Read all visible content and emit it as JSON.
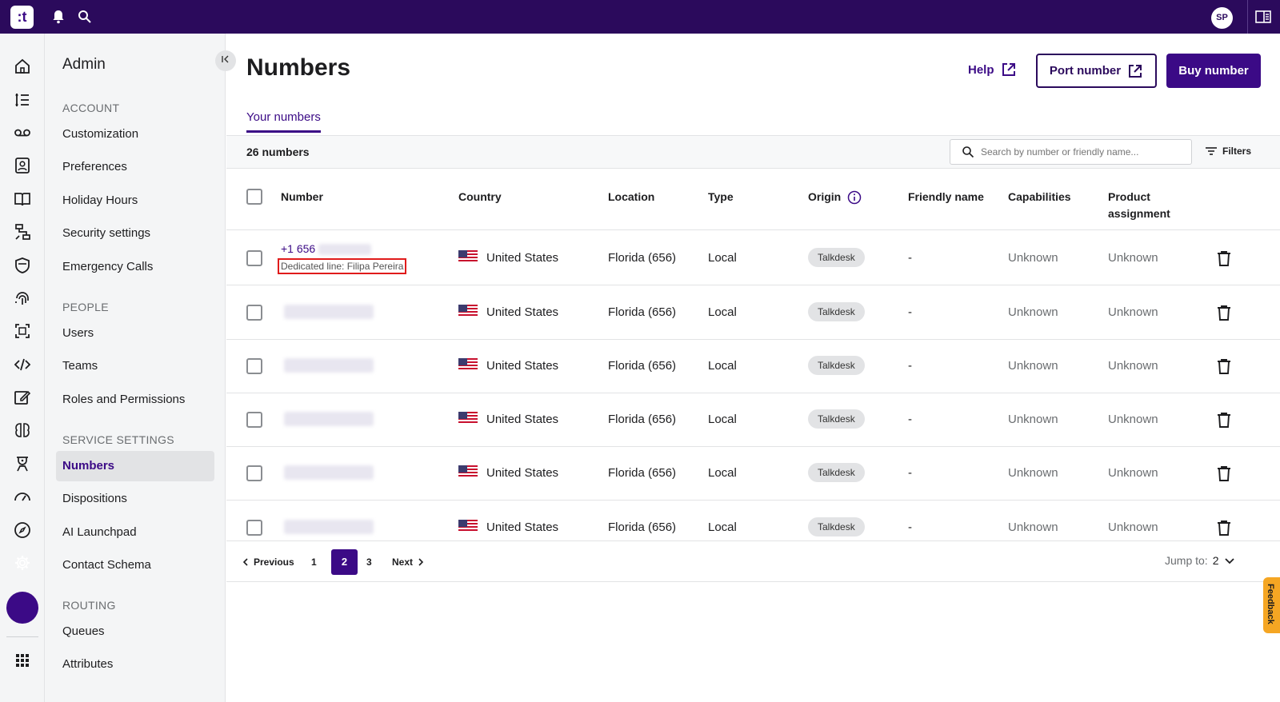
{
  "topbar": {
    "logo": ":t",
    "avatar": "SP"
  },
  "sidebar": {
    "title": "Admin",
    "sections": [
      {
        "label": "ACCOUNT",
        "items": [
          "Customization",
          "Preferences",
          "Holiday Hours",
          "Security settings",
          "Emergency Calls"
        ]
      },
      {
        "label": "PEOPLE",
        "items": [
          "Users",
          "Teams",
          "Roles and Permissions"
        ]
      },
      {
        "label": "SERVICE SETTINGS",
        "items": [
          "Numbers",
          "Dispositions",
          "AI Launchpad",
          "Contact Schema"
        ]
      },
      {
        "label": "ROUTING",
        "items": [
          "Queues",
          "Attributes"
        ]
      }
    ],
    "active_item": "Numbers"
  },
  "page": {
    "title": "Numbers",
    "help_label": "Help",
    "port_label": "Port number",
    "buy_label": "Buy number",
    "tab": "Your numbers",
    "count": "26 numbers",
    "search_placeholder": "Search by number or friendly name...",
    "filters_label": "Filters"
  },
  "table": {
    "headers": {
      "number": "Number",
      "country": "Country",
      "location": "Location",
      "type": "Type",
      "origin": "Origin",
      "friendly": "Friendly name",
      "capabilities": "Capabilities",
      "product_line1": "Product",
      "product_line2": "assignment"
    },
    "rows": [
      {
        "number": "+1 656",
        "dedicated": "Dedicated line: Filipa Pereira",
        "country": "United States",
        "location": "Florida (656)",
        "type": "Local",
        "origin": "Talkdesk",
        "friendly": "-",
        "capabilities": "Unknown",
        "product": "Unknown"
      },
      {
        "number": "",
        "country": "United States",
        "location": "Florida (656)",
        "type": "Local",
        "origin": "Talkdesk",
        "friendly": "-",
        "capabilities": "Unknown",
        "product": "Unknown"
      },
      {
        "number": "",
        "country": "United States",
        "location": "Florida (656)",
        "type": "Local",
        "origin": "Talkdesk",
        "friendly": "-",
        "capabilities": "Unknown",
        "product": "Unknown"
      },
      {
        "number": "",
        "country": "United States",
        "location": "Florida (656)",
        "type": "Local",
        "origin": "Talkdesk",
        "friendly": "-",
        "capabilities": "Unknown",
        "product": "Unknown"
      },
      {
        "number": "",
        "country": "United States",
        "location": "Florida (656)",
        "type": "Local",
        "origin": "Talkdesk",
        "friendly": "-",
        "capabilities": "Unknown",
        "product": "Unknown"
      },
      {
        "number": "",
        "country": "United States",
        "location": "Florida (656)",
        "type": "Local",
        "origin": "Talkdesk",
        "friendly": "-",
        "capabilities": "Unknown",
        "product": "Unknown"
      }
    ]
  },
  "pagination": {
    "previous": "Previous",
    "pages": [
      "1",
      "2",
      "3"
    ],
    "current": "2",
    "next": "Next",
    "jump_label": "Jump to:",
    "jump_value": "2"
  },
  "feedback_label": "Feedback",
  "colors": {
    "brand": "#2b0a5c",
    "accent": "#3b0a86",
    "highlight": "#e01b1b",
    "feedback": "#f5a623"
  }
}
